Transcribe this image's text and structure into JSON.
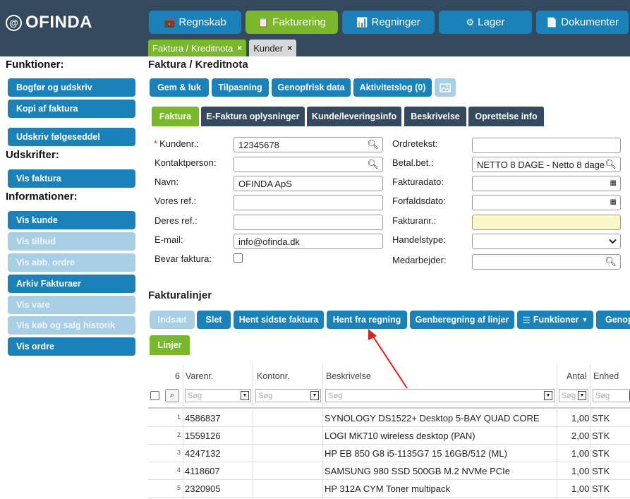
{
  "app": {
    "logo": "OFINDA",
    "logo_mark": "@"
  },
  "nav": [
    {
      "label": "Regnskab",
      "icon": "briefcase-icon",
      "glyph": "💼"
    },
    {
      "label": "Fakturering",
      "icon": "clipboard-icon",
      "glyph": "📋"
    },
    {
      "label": "Regninger",
      "icon": "bar-chart-icon",
      "glyph": "📊"
    },
    {
      "label": "Lager",
      "icon": "cubes-icon",
      "glyph": "⚙"
    },
    {
      "label": "Dokumenter",
      "icon": "document-icon",
      "glyph": "📄"
    }
  ],
  "open_tabs": [
    {
      "label": "Faktura / Kreditnota",
      "close": "×"
    },
    {
      "label": "Kunder",
      "close": "×"
    }
  ],
  "sidebar": {
    "funktioner_heading": "Funktioner:",
    "funktioner": [
      "Bogfør og udskriv",
      "Kopi af faktura",
      "Udskriv følgeseddel"
    ],
    "udskrifter_heading": "Udskrifter:",
    "udskrifter": [
      "Vis faktura"
    ],
    "informationer_heading": "Informationer:",
    "informationer": [
      "Vis kunde",
      "Vis tilbud",
      "Vis abb. ordre",
      "Arkiv Fakturaer",
      "Vis vare",
      "Vis køb og salg historik",
      "Vis ordre"
    ]
  },
  "main": {
    "title": "Faktura / Kreditnota",
    "toolbar": [
      "Gem & luk",
      "Tilpasning",
      "Genopfrisk data",
      "Aktivitetslog (0)"
    ],
    "subtabs": [
      "Faktura",
      "E-Faktura oplysninger",
      "Kunde/leveringsinfo",
      "Beskrivelse",
      "Oprettelse info"
    ]
  },
  "form": {
    "required_mark": "*",
    "kundenr_label": "Kundenr.:",
    "kundenr_value": "12345678",
    "kontaktperson_label": "Kontaktperson:",
    "kontaktperson_value": "",
    "navn_label": "Navn:",
    "navn_value": "OFINDA ApS",
    "vores_ref_label": "Vores ref.:",
    "vores_ref_value": "",
    "deres_ref_label": "Deres ref.:",
    "deres_ref_value": "",
    "email_label": "E-mail:",
    "email_value": "info@ofinda.dk",
    "bevar_label": "Bevar faktura:",
    "ordretekst_label": "Ordretekst:",
    "ordretekst_value": "",
    "betal_label": "Betal.bet.:",
    "betal_value": "NETTO 8 DAGE - Netto 8 dage",
    "fakturadato_label": "Fakturadato:",
    "fakturadato_value": "",
    "forfaldsdato_label": "Forfaldsdato:",
    "forfaldsdato_value": "",
    "fakturanr_label": "Fakturanr.:",
    "fakturanr_value": "",
    "handelstype_label": "Handelstype:",
    "handelstype_value": "",
    "medarbejder_label": "Medarbejder:",
    "medarbejder_value": ""
  },
  "lines": {
    "title": "Fakturalinjer",
    "buttons": [
      "Indsæt",
      "Slet",
      "Hent sidste faktura",
      "Hent fra regning",
      "Genberegning af linjer",
      "Funktioner",
      "Genop"
    ],
    "tab": "Linjer",
    "count": "6",
    "columns": [
      "Varenr.",
      "Kontonr.",
      "Beskrivelse",
      "Antal",
      "Enhed"
    ],
    "filter_placeholder": "Søg",
    "rows": [
      {
        "n": "1",
        "varenr": "4586837",
        "kontonr": "",
        "beskrivelse": "SYNOLOGY DS1522+ Desktop 5-BAY QUAD CORE",
        "antal": "1,00",
        "enhed": "STK"
      },
      {
        "n": "2",
        "varenr": "1559126",
        "kontonr": "",
        "beskrivelse": "LOGI MK710 wireless desktop (PAN)",
        "antal": "2,00",
        "enhed": "STK"
      },
      {
        "n": "3",
        "varenr": "4247132",
        "kontonr": "",
        "beskrivelse": "HP EB 850 G8 i5-1135G7 15 16GB/512 (ML)",
        "antal": "1,00",
        "enhed": "STK"
      },
      {
        "n": "4",
        "varenr": "4118607",
        "kontonr": "",
        "beskrivelse": "SAMSUNG 980 SSD 500GB M.2 NVMe PCIe",
        "antal": "1,00",
        "enhed": "STK"
      },
      {
        "n": "5",
        "varenr": "2320905",
        "kontonr": "",
        "beskrivelse": "HP 312A CYM Toner multipack",
        "antal": "1,00",
        "enhed": "STK"
      }
    ]
  },
  "colors": {
    "nav_blue": "#1a82b9",
    "active_green": "#78b82a",
    "header_dark": "#34495e",
    "annotation_red": "#e02020"
  }
}
